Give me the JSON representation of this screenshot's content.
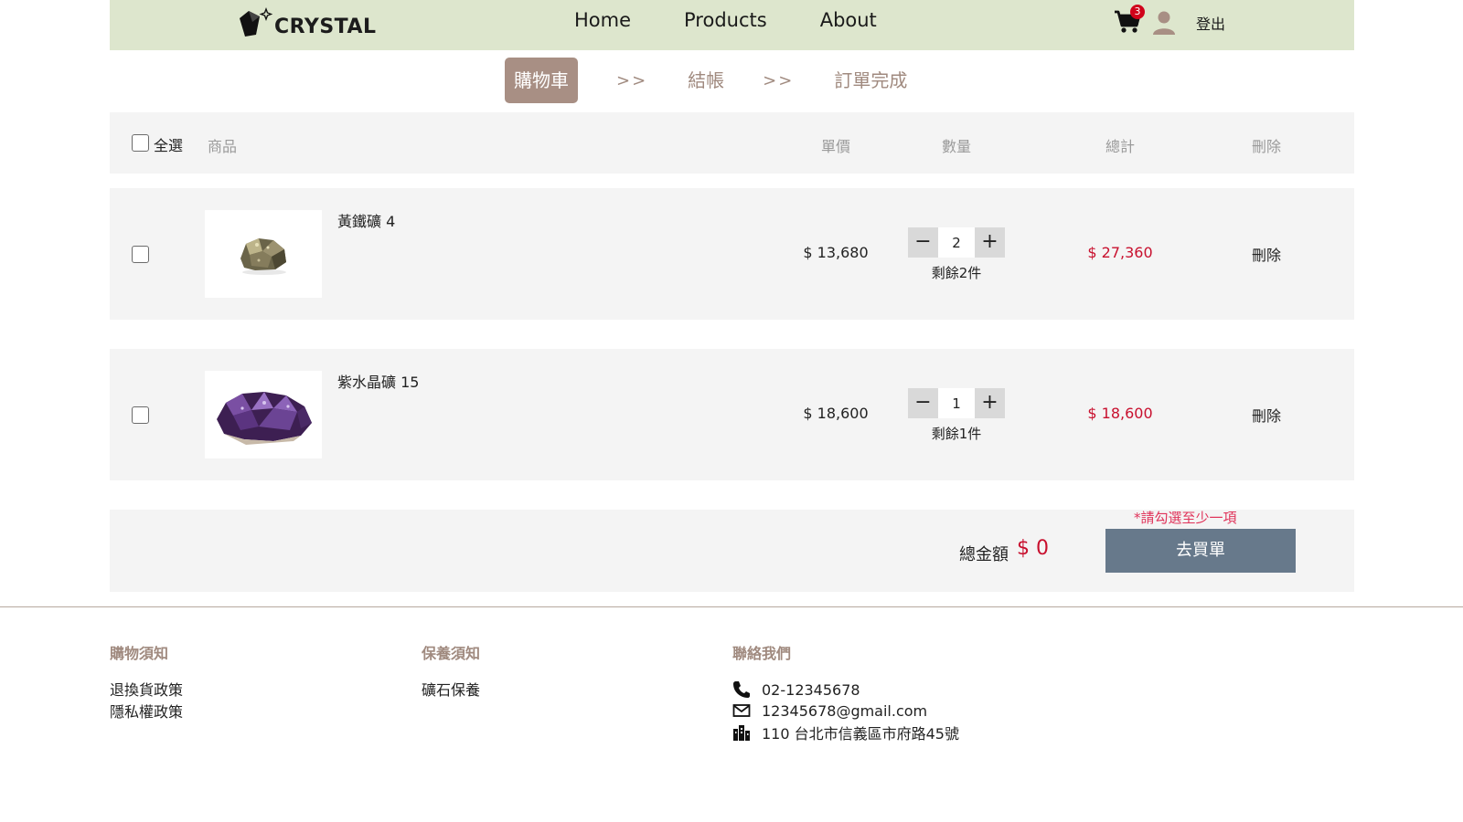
{
  "nav": {
    "logo_text": "CRYSTAL",
    "links": [
      "Home",
      "Products",
      "About"
    ],
    "cart_count": "3",
    "logout": "登出"
  },
  "steps": {
    "cart": "購物車",
    "sep": ">>",
    "checkout": "結帳",
    "done": "訂單完成"
  },
  "table_header": {
    "select_all": "全選",
    "product": "商品",
    "unit_price": "單價",
    "quantity": "數量",
    "total": "總計",
    "delete": "刪除"
  },
  "items": [
    {
      "name": "黃鐵礦 4",
      "unit_price": "$ 13,680",
      "quantity": "2",
      "remaining": "剩餘2件",
      "total": "$ 27,360",
      "delete": "刪除"
    },
    {
      "name": "紫水晶礦 15",
      "unit_price": "$ 18,600",
      "quantity": "1",
      "remaining": "剩餘1件",
      "total": "$ 18,600",
      "delete": "刪除"
    }
  ],
  "summary": {
    "warning": "*請勾選至少一項",
    "label": "總金額",
    "value": "$ 0",
    "button": "去買單"
  },
  "footer": {
    "shopping": {
      "title": "購物須知",
      "links": [
        "退換貨政策",
        "隱私權政策"
      ]
    },
    "care": {
      "title": "保養須知",
      "links": [
        "礦石保養"
      ]
    },
    "contact": {
      "title": "聯絡我們",
      "phone": "02-12345678",
      "email": "12345678@gmail.com",
      "address": "110 台北市信義區市府路45號"
    }
  },
  "colors": {
    "nav_bg": "#dde6cd",
    "accent": "#a88f84",
    "price_red": "#c8102e",
    "checkout_btn": "#67798b",
    "warning": "#e0335a"
  }
}
